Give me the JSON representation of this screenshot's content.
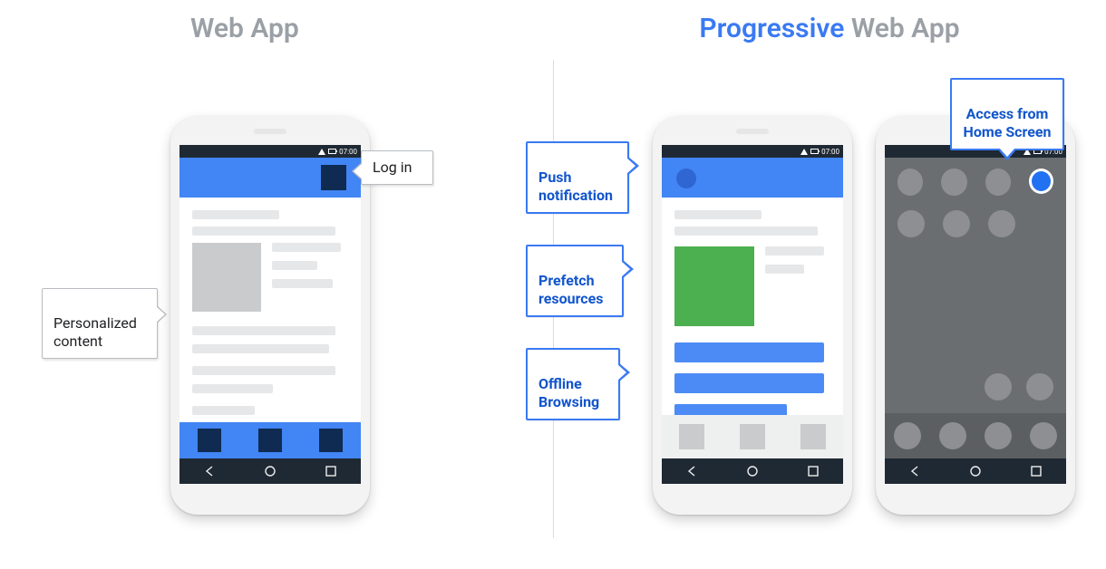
{
  "titles": {
    "left": "Web App",
    "right_accent": "Progressive",
    "right_rest": " Web App"
  },
  "left": {
    "callouts": {
      "login": "Log in",
      "personalized": "Personalized\ncontent"
    },
    "status_time": "07:00"
  },
  "right": {
    "callouts": {
      "push": "Push\nnotification",
      "prefetch": "Prefetch\nresources",
      "offline": "Offline\nBrowsing",
      "homescreen": "Access from\nHome Screen"
    },
    "status_time": "07:00"
  }
}
